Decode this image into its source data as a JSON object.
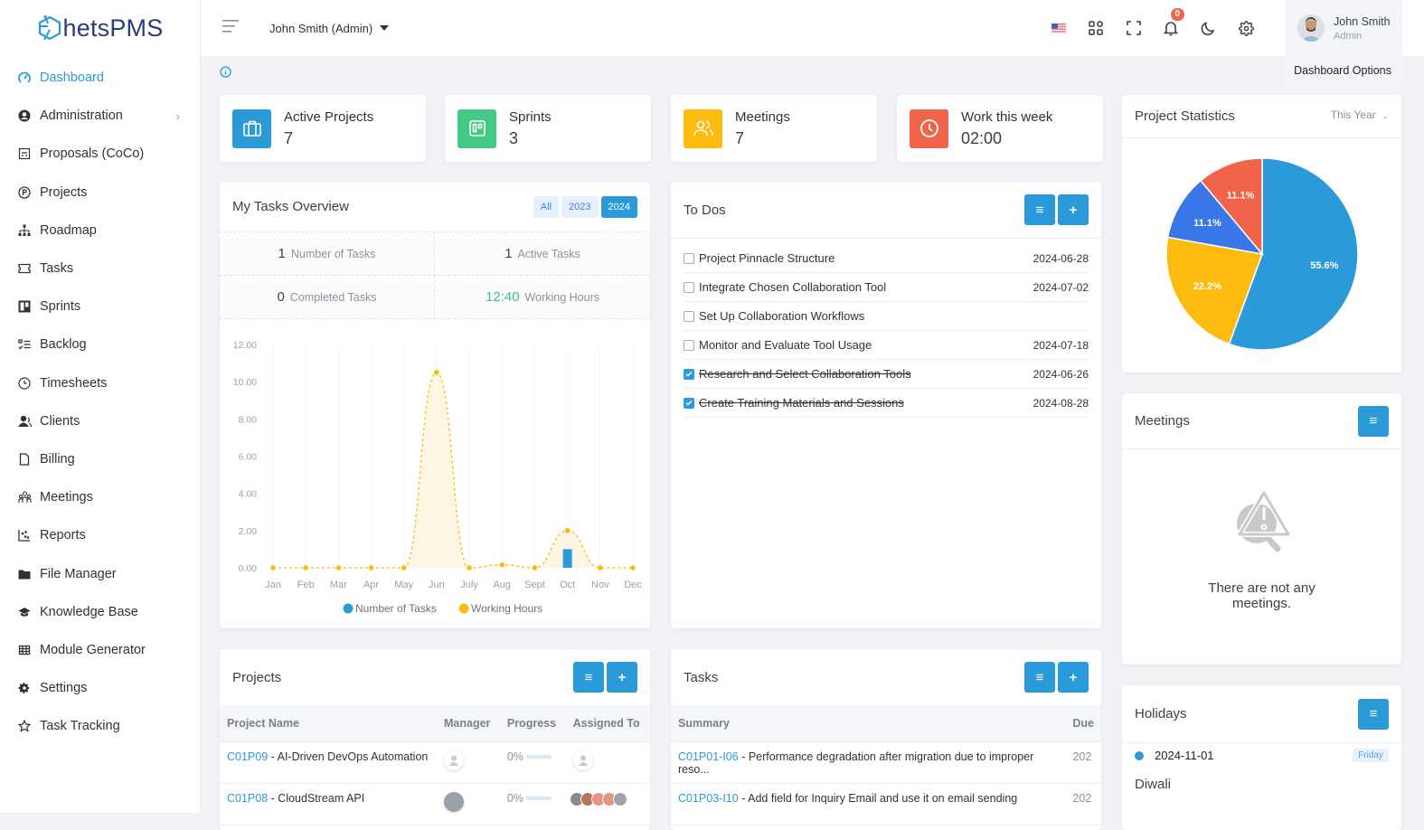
{
  "app": {
    "brand": "hetsPMS"
  },
  "sidebar": {
    "items": [
      {
        "label": "Dashboard",
        "icon": "dashboard-gauge-icon",
        "active": true
      },
      {
        "label": "Administration",
        "icon": "user-circle-icon",
        "has_children": true
      },
      {
        "label": "Proposals (CoCo)",
        "icon": "proposal-icon"
      },
      {
        "label": "Projects",
        "icon": "projects-p-icon"
      },
      {
        "label": "Roadmap",
        "icon": "sitemap-icon"
      },
      {
        "label": "Tasks",
        "icon": "ticket-icon"
      },
      {
        "label": "Sprints",
        "icon": "board-icon"
      },
      {
        "label": "Backlog",
        "icon": "checklist-icon"
      },
      {
        "label": "Timesheets",
        "icon": "clock-icon"
      },
      {
        "label": "Clients",
        "icon": "users-icon"
      },
      {
        "label": "Billing",
        "icon": "file-icon"
      },
      {
        "label": "Meetings",
        "icon": "people-group-icon"
      },
      {
        "label": "Reports",
        "icon": "scatter-chart-icon"
      },
      {
        "label": "File Manager",
        "icon": "folder-icon"
      },
      {
        "label": "Knowledge Base",
        "icon": "graduation-cap-icon"
      },
      {
        "label": "Module Generator",
        "icon": "grid-table-icon"
      },
      {
        "label": "Settings",
        "icon": "gear-icon"
      },
      {
        "label": "Task Tracking",
        "icon": "star-icon"
      }
    ]
  },
  "topbar": {
    "user_switch": "John Smith (Admin)",
    "notification_count": "0",
    "profile_name": "John Smith",
    "profile_role": "Admin",
    "dashboard_options": "Dashboard Options"
  },
  "stats": [
    {
      "label": "Active Projects",
      "value": "7",
      "color": "#2a9bd8",
      "icon": "briefcase-icon"
    },
    {
      "label": "Sprints",
      "value": "3",
      "color": "#45c987",
      "icon": "trello-board-icon"
    },
    {
      "label": "Meetings",
      "value": "7",
      "color": "#fdbb0f",
      "icon": "users-icon"
    },
    {
      "label": "Work this week",
      "value": "02:00",
      "color": "#f0644a",
      "icon": "clock-icon"
    }
  ],
  "tasks_overview": {
    "title": "My Tasks Overview",
    "filters": [
      "All",
      "2023",
      "2024"
    ],
    "active_filter": "2024",
    "kpis": [
      {
        "value": "1",
        "label": "Number of Tasks"
      },
      {
        "value": "1",
        "label": "Active Tasks"
      },
      {
        "value": "0",
        "label": "Completed Tasks"
      },
      {
        "value": "12:40",
        "label": "Working Hours"
      }
    ]
  },
  "chart_data": [
    {
      "type": "bar",
      "title": "My Tasks Overview",
      "categories": [
        "Jan",
        "Feb",
        "Mar",
        "Apr",
        "May",
        "Jun",
        "July",
        "Aug",
        "Sept",
        "Oct",
        "Nov",
        "Dec"
      ],
      "series": [
        {
          "name": "Number of Tasks",
          "type": "bar",
          "color": "#2a9bd8",
          "values": [
            0,
            0,
            0,
            0,
            0,
            0,
            0,
            0,
            0,
            1,
            0,
            0
          ]
        },
        {
          "name": "Working Hours",
          "type": "area",
          "color": "#fdbb0f",
          "values": [
            0,
            0,
            0,
            0,
            0,
            10.5,
            0,
            0.17,
            0,
            2,
            0,
            0
          ]
        }
      ],
      "yticks": [
        "0.00",
        "2.00",
        "4.00",
        "6.00",
        "8.00",
        "10.00",
        "12.00"
      ],
      "ylim": [
        0,
        12
      ],
      "legend": "bottom"
    },
    {
      "type": "pie",
      "title": "Project Statistics",
      "labels_shown": [
        "55.6%",
        "22.2%",
        "11.1%",
        "11.1%"
      ],
      "values": [
        55.6,
        22.2,
        11.1,
        11.1
      ],
      "colors": [
        "#2a9bd8",
        "#fdbb0f",
        "#3a78ea",
        "#f0644a"
      ]
    }
  ],
  "todos": {
    "title": "To Dos",
    "items": [
      {
        "text": "Project Pinnacle Structure",
        "date": "2024-06-28",
        "done": false
      },
      {
        "text": "Integrate Chosen Collaboration Tool",
        "date": "2024-07-02",
        "done": false
      },
      {
        "text": "Set Up Collaboration Workflows",
        "date": "",
        "done": false
      },
      {
        "text": "Monitor and Evaluate Tool Usage",
        "date": "2024-07-18",
        "done": false
      },
      {
        "text": "Research and Select Collaboration Tools",
        "date": "2024-06-26",
        "done": true
      },
      {
        "text": "Create Training Materials and Sessions",
        "date": "2024-08-28",
        "done": true
      }
    ]
  },
  "project_stats": {
    "title": "Project Statistics",
    "period": "This Year"
  },
  "meetings": {
    "title": "Meetings",
    "empty_text": "There are not any meetings."
  },
  "holidays": {
    "title": "Holidays",
    "items": [
      {
        "date": "2024-11-01",
        "day": "Friday",
        "name": "Diwali"
      }
    ]
  },
  "projects": {
    "title": "Projects",
    "columns": [
      "Project Name",
      "Manager",
      "Progress",
      "Assigned To"
    ],
    "rows": [
      {
        "code": "C01P09",
        "name": " - AI-Driven DevOps Automation",
        "progress": "0%",
        "progress_value": 0
      },
      {
        "code": "C01P08",
        "name": " - CloudStream API",
        "progress": "0%",
        "progress_value": 0
      }
    ]
  },
  "tasks": {
    "title": "Tasks",
    "columns": [
      "Summary",
      "Due"
    ],
    "rows": [
      {
        "code": "C01P01-I06",
        "summary": " - Performance degradation after migration due to improper reso...",
        "due": "202"
      },
      {
        "code": "C01P03-I10",
        "summary": " - Add field for Inquiry Email and use it on email sending",
        "due": "202"
      }
    ]
  }
}
